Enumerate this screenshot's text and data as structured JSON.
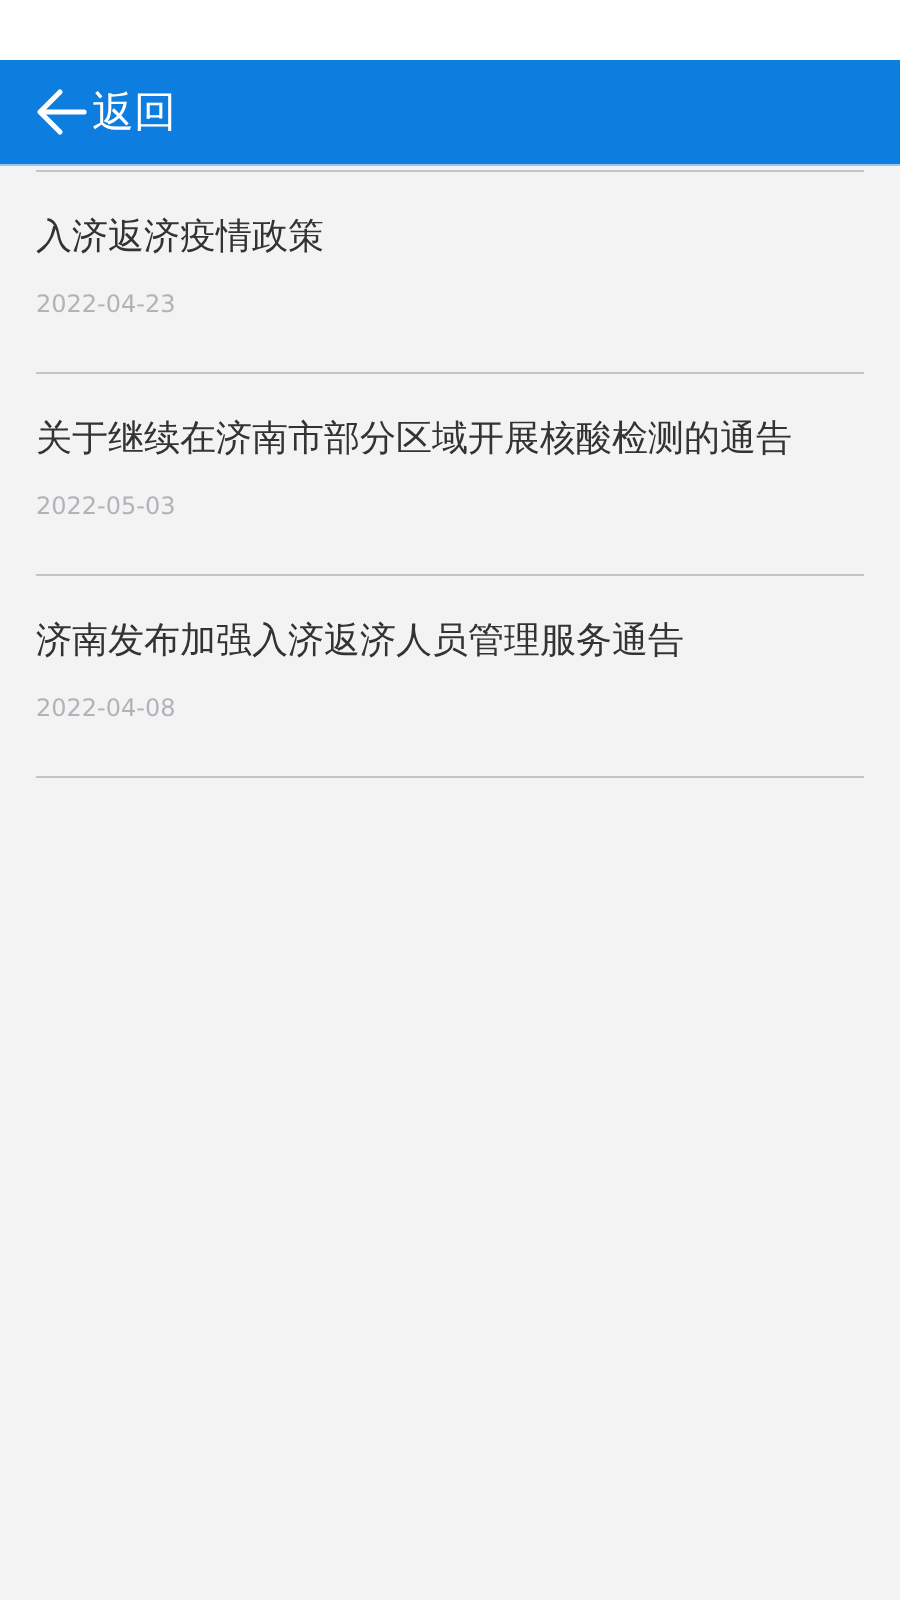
{
  "header": {
    "back_label": "返回"
  },
  "notices": [
    {
      "title": "入济返济疫情政策",
      "date": "2022-04-23"
    },
    {
      "title": "关于继续在济南市部分区域开展核酸检测的通告",
      "date": "2022-05-03"
    },
    {
      "title": "济南发布加强入济返济人员管理服务通告",
      "date": "2022-04-08"
    }
  ]
}
